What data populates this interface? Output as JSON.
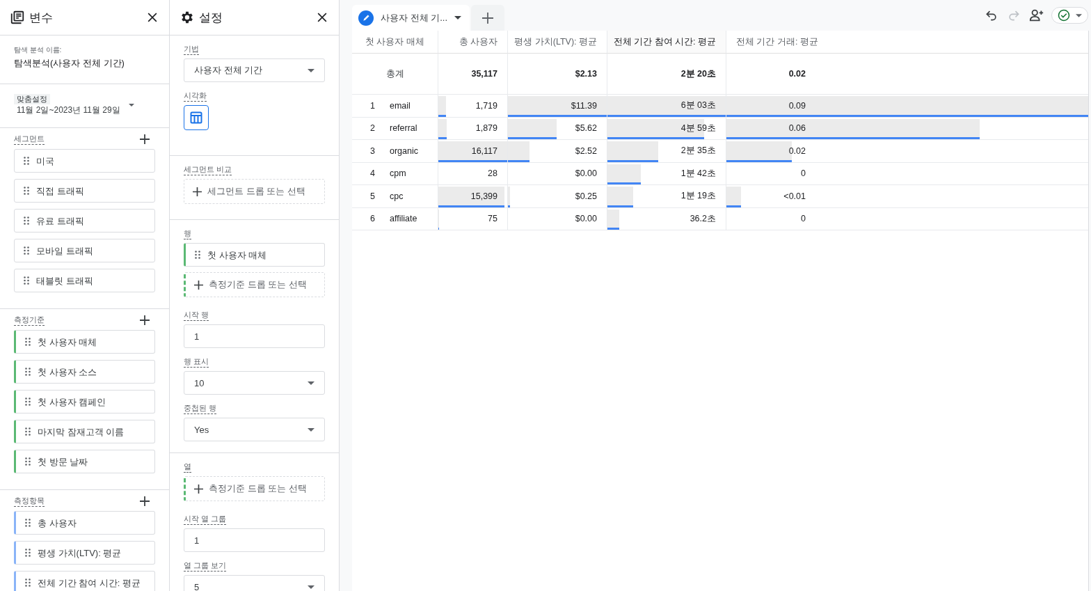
{
  "variables_panel": {
    "title": "변수",
    "exploration_name_label": "탐색 분석 이름:",
    "exploration_name": "탐색분석(사용자 전체 기간)",
    "date_range_label": "맞춤설정",
    "date_range": "11월 2일~2023년 11월 29일",
    "sections": [
      {
        "kind": "segment",
        "title": "세그먼트",
        "items": [
          "미국",
          "직접 트래픽",
          "유료 트래픽",
          "모바일 트래픽",
          "태블릿 트래픽"
        ]
      },
      {
        "kind": "dimension",
        "title": "측정기준",
        "items": [
          "첫 사용자 매체",
          "첫 사용자 소스",
          "첫 사용자 캠페인",
          "마지막 잠재고객 이름",
          "첫 방문 날짜"
        ]
      },
      {
        "kind": "metric",
        "title": "측정항목",
        "items": [
          "총 사용자",
          "평생 가치(LTV): 평균",
          "전체 기간 참여 시간: 평균"
        ]
      }
    ]
  },
  "settings_panel": {
    "title": "설정",
    "technique": {
      "label": "기법",
      "value": "사용자 전체 기간"
    },
    "visualization": {
      "label": "시각화",
      "selected": true
    },
    "segment_comparison": {
      "label": "세그먼트 비교",
      "drop_hint": "세그먼트 드롭 또는 선택"
    },
    "rows": {
      "label": "행",
      "items": [
        "첫 사용자 매체"
      ],
      "drop_hint": "측정기준 드롭 또는 선택",
      "start_row": {
        "label": "시작 행",
        "value": "1"
      },
      "show_rows": {
        "label": "행 표시",
        "value": "10"
      },
      "nested_rows": {
        "label": "중첩된 행",
        "value": "Yes"
      }
    },
    "columns": {
      "label": "열",
      "drop_hint": "측정기준 드롭 또는 선택",
      "start_group": {
        "label": "시작 열 그룹",
        "value": "1"
      },
      "show_groups": {
        "label": "열 그룹 보기",
        "value": "5"
      }
    }
  },
  "tab": {
    "label": "사용자 전체 기...",
    "selected": true
  },
  "toolbar": [
    {
      "kind": "undo",
      "disabled": false
    },
    {
      "kind": "redo",
      "disabled": true
    },
    {
      "kind": "share",
      "disabled": false
    }
  ],
  "table": {
    "dimension_column": {
      "label": "첫 사용자 매체"
    },
    "metric_columns": [
      {
        "label": "총 사용자",
        "sorted": false
      },
      {
        "label": "평생 가치(LTV): 평균",
        "sorted": false
      },
      {
        "label": "전체 기간 참여 시간: 평균",
        "sorted": true
      },
      {
        "label": "전체 기간 거래: 평균",
        "sorted": false
      }
    ],
    "totals": {
      "label": "총계",
      "values": [
        "35,117",
        "$2.13",
        "2분 20초",
        "0.02"
      ]
    },
    "rows": [
      {
        "index": "1",
        "name": "email",
        "cells": [
          {
            "value": "1,719",
            "level": 0.107
          },
          {
            "value": "$11.39",
            "level": 1
          },
          {
            "value": "6분 03초",
            "level": 1
          },
          {
            "value": "0.09",
            "level": 1
          }
        ]
      },
      {
        "index": "2",
        "name": "referral",
        "cells": [
          {
            "value": "1,879",
            "level": 0.117
          },
          {
            "value": "$5.62",
            "level": 0.49
          },
          {
            "value": "4분 59초",
            "level": 0.82
          },
          {
            "value": "0.06",
            "level": 0.7
          }
        ]
      },
      {
        "index": "3",
        "name": "organic",
        "cells": [
          {
            "value": "16,117",
            "level": 1
          },
          {
            "value": "$2.52",
            "level": 0.22
          },
          {
            "value": "2분 35초",
            "level": 0.43
          },
          {
            "value": "0.02",
            "level": 0.18
          }
        ]
      },
      {
        "index": "4",
        "name": "cpm",
        "cells": [
          {
            "value": "28"
          },
          {
            "value": "$0.00"
          },
          {
            "value": "1분 42초",
            "level": 0.28
          },
          {
            "value": "0"
          }
        ]
      },
      {
        "index": "5",
        "name": "cpc",
        "cells": [
          {
            "value": "15,399",
            "level": 0.955
          },
          {
            "value": "$0.25",
            "level": 0.02
          },
          {
            "value": "1분 19초",
            "level": 0.22
          },
          {
            "value": "<0.01",
            "level": 0.04
          }
        ]
      },
      {
        "index": "6",
        "name": "affiliate",
        "cells": [
          {
            "value": "75",
            "level": 0.005
          },
          {
            "value": "$0.00"
          },
          {
            "value": "36.2초",
            "level": 0.1
          },
          {
            "value": "0"
          }
        ]
      }
    ]
  }
}
